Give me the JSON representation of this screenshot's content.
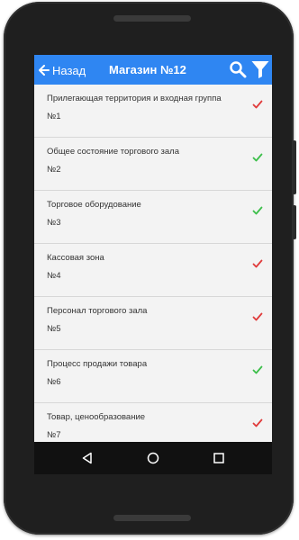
{
  "header": {
    "back_label": "Назад",
    "title": "Магазин №12",
    "icons": [
      "back-arrow-icon",
      "search-icon",
      "filter-icon"
    ]
  },
  "items": [
    {
      "name": "Прилегающая территория и входная группа",
      "number": "№1",
      "status": "fail"
    },
    {
      "name": "Общее состояние торгового зала",
      "number": "№2",
      "status": "ok"
    },
    {
      "name": "Торговое оборудование",
      "number": "№3",
      "status": "ok"
    },
    {
      "name": "Кассовая зона",
      "number": "№4",
      "status": "fail"
    },
    {
      "name": "Персонал торгового зала",
      "number": "№5",
      "status": "fail"
    },
    {
      "name": "Процесс продажи товара",
      "number": "№6",
      "status": "ok"
    },
    {
      "name": "Товар, ценообразование",
      "number": "№7",
      "status": "fail"
    }
  ],
  "colors": {
    "accent": "#2f86f2",
    "ok": "#3cbf4a",
    "fail": "#e03b3b"
  },
  "navbar": {
    "icons": [
      "nav-back-icon",
      "nav-home-icon",
      "nav-recent-icon"
    ]
  }
}
